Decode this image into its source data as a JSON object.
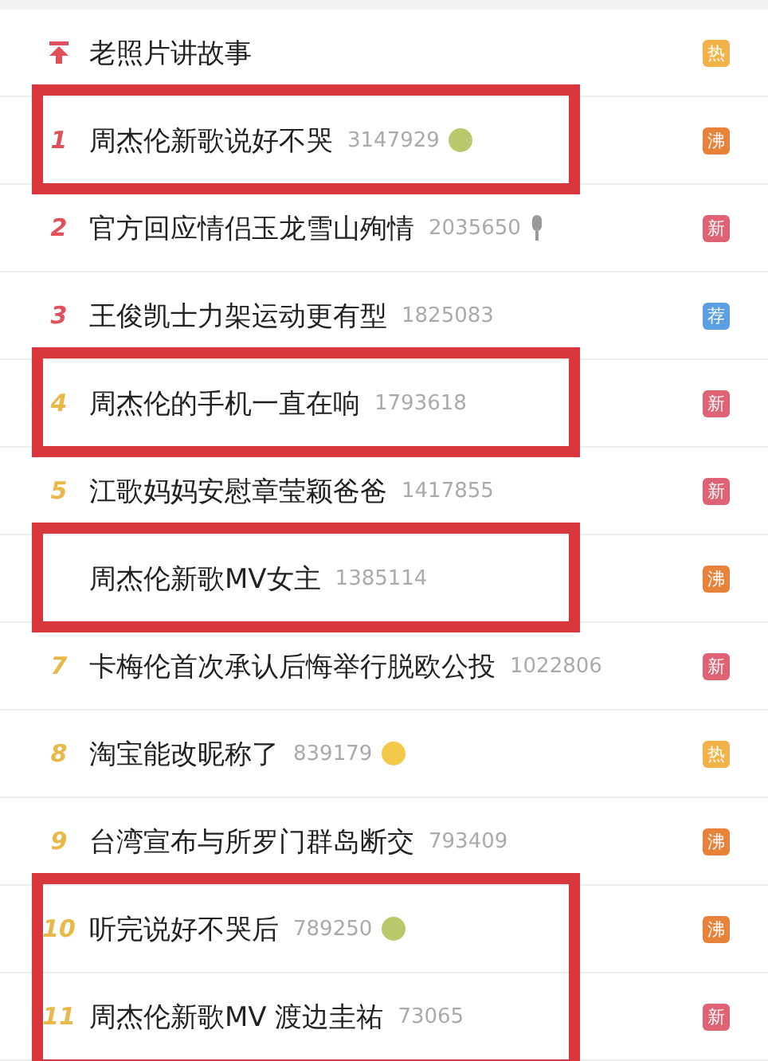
{
  "rows": [
    {
      "kind": "pinned",
      "title": "老照片讲故事",
      "badge": {
        "text": "热",
        "color": "#f2b24a"
      },
      "boxed": false
    },
    {
      "kind": "ranked",
      "rank": "1",
      "title": "周杰伦新歌说好不哭",
      "count": "3147929",
      "has_icon": true,
      "badge": {
        "text": "沸",
        "color": "#e8823a"
      },
      "boxed": true
    },
    {
      "kind": "ranked",
      "rank": "2",
      "title": "官方回应情侣玉龙雪山殉情",
      "count": "2035650",
      "has_icon": true,
      "badge": {
        "text": "新",
        "color": "#e06275"
      },
      "boxed": false
    },
    {
      "kind": "ranked",
      "rank": "3",
      "title": "王俊凯士力架运动更有型",
      "count": "1825083",
      "badge": {
        "text": "荐",
        "color": "#5a9fe2"
      },
      "boxed": false
    },
    {
      "kind": "ranked",
      "rank": "4",
      "title": "周杰伦的手机一直在响",
      "count": "1793618",
      "badge": {
        "text": "新",
        "color": "#e06275"
      },
      "boxed": true
    },
    {
      "kind": "ranked",
      "rank": "5",
      "title": "江歌妈妈安慰章莹颖爸爸",
      "count": "1417855",
      "badge": {
        "text": "新",
        "color": "#e06275"
      },
      "boxed": false
    },
    {
      "kind": "unranked",
      "title": "周杰伦新歌MV女主",
      "count": "1385114",
      "badge": {
        "text": "沸",
        "color": "#e8823a"
      },
      "boxed": true
    },
    {
      "kind": "ranked",
      "rank": "7",
      "title": "卡梅伦首次承认后悔举行脱欧公投",
      "count": "1022806",
      "badge": {
        "text": "新",
        "color": "#e06275"
      },
      "boxed": false
    },
    {
      "kind": "ranked",
      "rank": "8",
      "title": "淘宝能改昵称了",
      "count": "839179",
      "has_icon": true,
      "badge": {
        "text": "热",
        "color": "#f2b24a"
      },
      "boxed": false
    },
    {
      "kind": "ranked",
      "rank": "9",
      "title": "台湾宣布与所罗门群岛断交",
      "count": "793409",
      "badge": {
        "text": "沸",
        "color": "#e8823a"
      },
      "boxed": false
    },
    {
      "kind": "ranked",
      "rank": "10",
      "title": "听完说好不哭后",
      "count": "789250",
      "has_icon": true,
      "badge": {
        "text": "沸",
        "color": "#e8823a"
      },
      "boxed": true
    },
    {
      "kind": "ranked",
      "rank": "11",
      "title": "周杰伦新歌MV 渡边圭祐",
      "count": "73065",
      "badge": {
        "text": "新",
        "color": "#e06275"
      },
      "boxed": true
    }
  ]
}
